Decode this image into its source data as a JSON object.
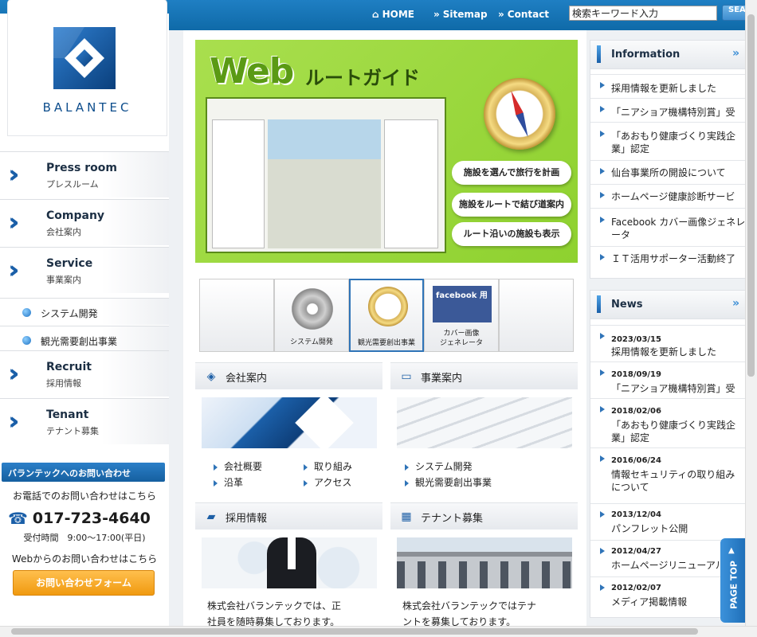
{
  "topnav": {
    "home": "HOME",
    "sitemap": "Sitemap",
    "contact": "Contact",
    "search_value": "検索キーワード入力",
    "search_button": "SEA"
  },
  "logo": {
    "text": "BALANTEC"
  },
  "sidebar": {
    "items": [
      {
        "en": "Press room",
        "ja": "プレスルーム"
      },
      {
        "en": "Company",
        "ja": "会社案内"
      },
      {
        "en": "Service",
        "ja": "事業案内"
      },
      {
        "en": "Recruit",
        "ja": "採用情報"
      },
      {
        "en": "Tenant",
        "ja": "テナント募集"
      }
    ],
    "subitems": [
      "システム開発",
      "観光需要創出事業"
    ]
  },
  "contact": {
    "heading": "バランテックへのお問い合わせ",
    "phone_intro": "お電話でのお問い合わせはこちら",
    "phone": "017-723-4640",
    "hours": "受付時間　9:00～17:00(平日)",
    "web_intro": "Webからのお問い合わせはこちら",
    "form_button": "お問い合わせフォーム"
  },
  "hero": {
    "title": "Web",
    "subtitle": "ルートガイド",
    "pills": [
      "施設を選んで旅行を計画",
      "施設をルートで結び道案内",
      "ルート沿いの施設も表示"
    ]
  },
  "thumbs": {
    "system": "システム開発",
    "tourism": "観光需要創出事業",
    "facebook_badge": "facebook 用",
    "facebook_line1": "カバー画像",
    "facebook_line2": "ジェネレータ"
  },
  "sections": {
    "company": {
      "title": "会社案内",
      "links": [
        "会社概要",
        "取り組み",
        "沿革",
        "アクセス"
      ]
    },
    "service": {
      "title": "事業案内",
      "links": [
        "システム開発",
        "観光需要創出事業"
      ]
    },
    "recruit": {
      "title": "採用情報",
      "text_line1": "株式会社バランテックでは、正",
      "text_line2": "社員を随時募集しております。"
    },
    "tenant": {
      "title": "テナント募集",
      "text_line1": "株式会社バランテックではテナ",
      "text_line2": "ントを募集しております。"
    }
  },
  "information": {
    "title": "Information",
    "more": "»",
    "items": [
      "採用情報を更新しました",
      "「ニアショア機構特別賞」受",
      "「あおもり健康づくり実践企",
      "業」認定",
      "仙台事業所の開設について",
      "ホームページ健康診断サービ",
      "Facebook カバー画像ジェネレ",
      "ータ",
      "ＩＴ活用サポーター活動終了"
    ]
  },
  "news": {
    "title": "News",
    "more": "»",
    "items": [
      {
        "date": "2023/03/15",
        "l1": "採用情報を更新しました",
        "l2": ""
      },
      {
        "date": "2018/09/19",
        "l1": "「ニアショア機構特別賞」受",
        "l2": ""
      },
      {
        "date": "2018/02/06",
        "l1": "「あおもり健康づくり実践企",
        "l2": "業」認定"
      },
      {
        "date": "2016/06/24",
        "l1": "情報セキュリティの取り組み",
        "l2": "について"
      },
      {
        "date": "2013/12/04",
        "l1": "パンフレット公開",
        "l2": ""
      },
      {
        "date": "2012/04/27",
        "l1": "ホームページリニューアル",
        "l2": ""
      },
      {
        "date": "2012/02/07",
        "l1": "メディア掲載情報",
        "l2": ""
      }
    ]
  },
  "pagetop": {
    "label": "PAGE TOP"
  },
  "colors": {
    "brand": "#1a5fa8",
    "topbar": "#1f7fc3",
    "accent_orange": "#f09a10",
    "hero_green": "#a9df4e"
  }
}
